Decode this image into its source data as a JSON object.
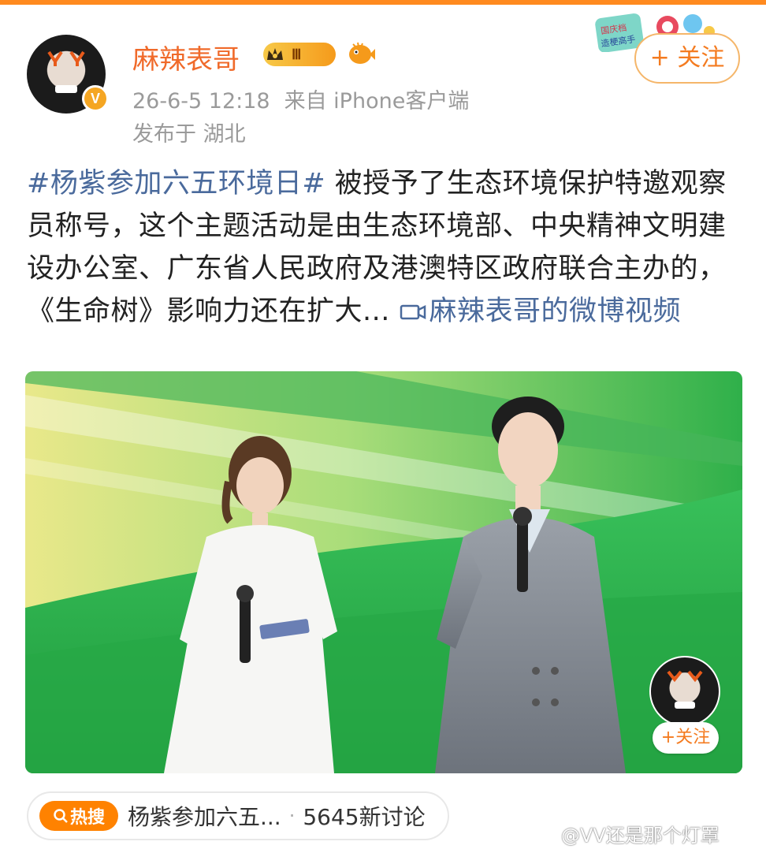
{
  "header": {
    "username": "麻辣表哥",
    "level_badge": "Ⅲ",
    "verified_mark": "V",
    "timestamp": "26-6-5 12:18",
    "source": "来自 iPhone客户端",
    "location": "发布于 湖北",
    "follow_label": "+ 关注",
    "festival_badge_text": "国庆档 造梗高手"
  },
  "post": {
    "hashtag": "#杨紫参加六五环境日#",
    "body": " 被授予了生态环境保护特邀观察员称号，这个主题活动是由生态环境部、中央精神文明建设办公室、广东省人民政府及港澳特区政府联合主办的，《生命树》影响力还在扩大... ",
    "video_link": "麻辣表哥的微博视频"
  },
  "video": {
    "overlay_follow_label": "+关注"
  },
  "hot_search": {
    "tag_label": "热搜",
    "topic": "杨紫参加六五...",
    "separator": "·",
    "count": "5645新讨论"
  },
  "watermark": "@VV还是那个灯罩",
  "colors": {
    "accent_orange": "#f47b20",
    "link_blue": "#4a6a9c",
    "username_orange": "#f06a2a"
  }
}
